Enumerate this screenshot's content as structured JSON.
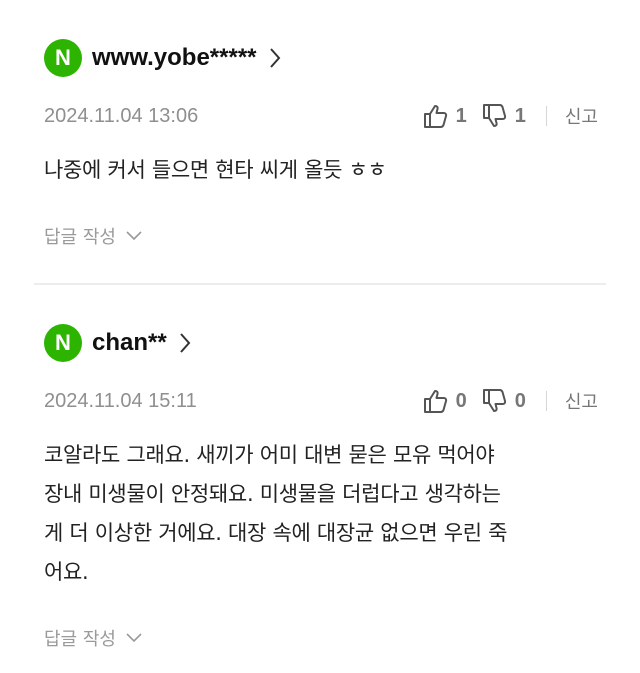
{
  "comments": [
    {
      "badge": "N",
      "username": "www.yobe*****",
      "date": "2024.11.04 13:06",
      "likes": "1",
      "dislikes": "1",
      "report_label": "신고",
      "body": "나중에 커서 들으면 현타 씨게 올듯 ㅎㅎ",
      "reply_label": "답글 작성"
    },
    {
      "badge": "N",
      "username": "chan**",
      "date": "2024.11.04 15:11",
      "likes": "0",
      "dislikes": "0",
      "report_label": "신고",
      "body_lines": [
        "코알라도 그래요. 새끼가 어미 대변 묻은 모유 먹어야",
        "장내 미생물이 안정돼요. 미생물을 더럽다고 생각하는",
        "게 더 이상한 거에요. 대장 속에 대장균 없으면 우린 죽",
        "어요."
      ],
      "reply_label": "답글 작성"
    }
  ],
  "colors": {
    "badge": "#2db400",
    "meta": "#8f8f8f",
    "divider": "#ececec"
  },
  "icons": [
    "chevron-right-icon",
    "thumbs-up-icon",
    "thumbs-down-icon",
    "chevron-down-icon"
  ]
}
